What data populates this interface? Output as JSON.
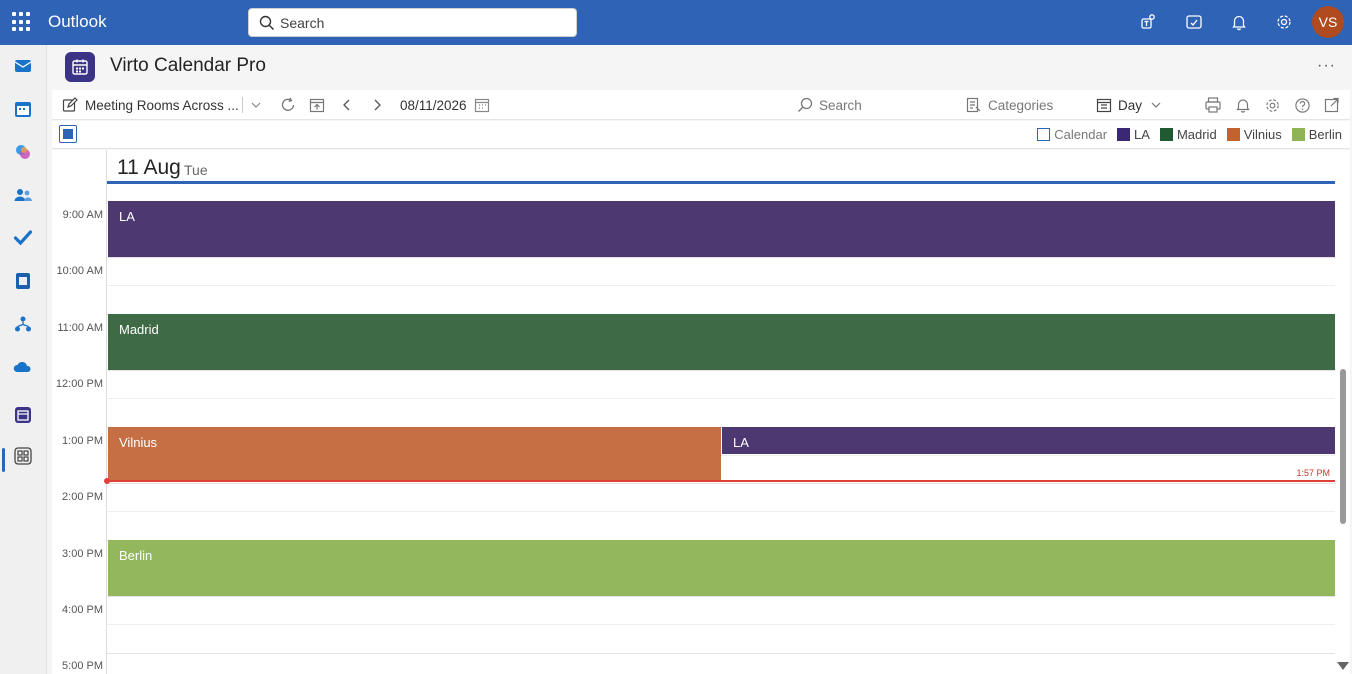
{
  "topbar": {
    "app_name": "Outlook",
    "search_placeholder": "Search",
    "avatar_initials": "VS",
    "avatar_color": "#b04a1f",
    "icons": [
      "teams-icon",
      "my-day-icon",
      "bell-icon",
      "gear-icon"
    ]
  },
  "rail": {
    "items": [
      "mail-icon",
      "calendar-icon",
      "copilot-icon",
      "people-icon",
      "todo-icon",
      "word-icon",
      "org-explorer-icon",
      "onedrive-icon",
      "virto-calendar-icon",
      "more-apps-icon"
    ],
    "active": "virto-calendar-icon"
  },
  "app": {
    "title": "Virto Calendar Pro",
    "more": "···"
  },
  "toolbar": {
    "view_name": "Meeting Rooms Across ...",
    "date": "08/11/2026",
    "search_placeholder": "Search",
    "categories": "Categories",
    "view_mode": "Day"
  },
  "legend": [
    {
      "label": "Calendar",
      "color": "#ffffff",
      "outline": "#2f63b6"
    },
    {
      "label": "LA",
      "color": "#3a2875"
    },
    {
      "label": "Madrid",
      "color": "#1f5a32"
    },
    {
      "label": "Vilnius",
      "color": "#c4622d"
    },
    {
      "label": "Berlin",
      "color": "#8fb356"
    }
  ],
  "day": {
    "number": "11 Aug",
    "weekday": "Tue"
  },
  "times": [
    "9:00 AM",
    "10:00 AM",
    "11:00 AM",
    "12:00 PM",
    "1:00 PM",
    "2:00 PM",
    "3:00 PM",
    "4:00 PM",
    "5:00 PM"
  ],
  "events": [
    {
      "label": "LA",
      "color": "#4e3871",
      "start": "9:00 AM",
      "end": "10:00 AM"
    },
    {
      "label": "Madrid",
      "color": "#3f6a46",
      "start": "11:00 AM",
      "end": "12:00 PM"
    },
    {
      "label": "Vilnius",
      "color": "#c66f45",
      "start": "1:00 PM",
      "end": "2:00 PM"
    },
    {
      "label": "LA",
      "color": "#4e3871",
      "start": "1:00 PM",
      "end": "1:30 PM"
    },
    {
      "label": "Berlin",
      "color": "#92b75c",
      "start": "3:00 PM",
      "end": "4:00 PM"
    }
  ],
  "now": {
    "label": "1:57 PM",
    "color": "#e0403a"
  }
}
